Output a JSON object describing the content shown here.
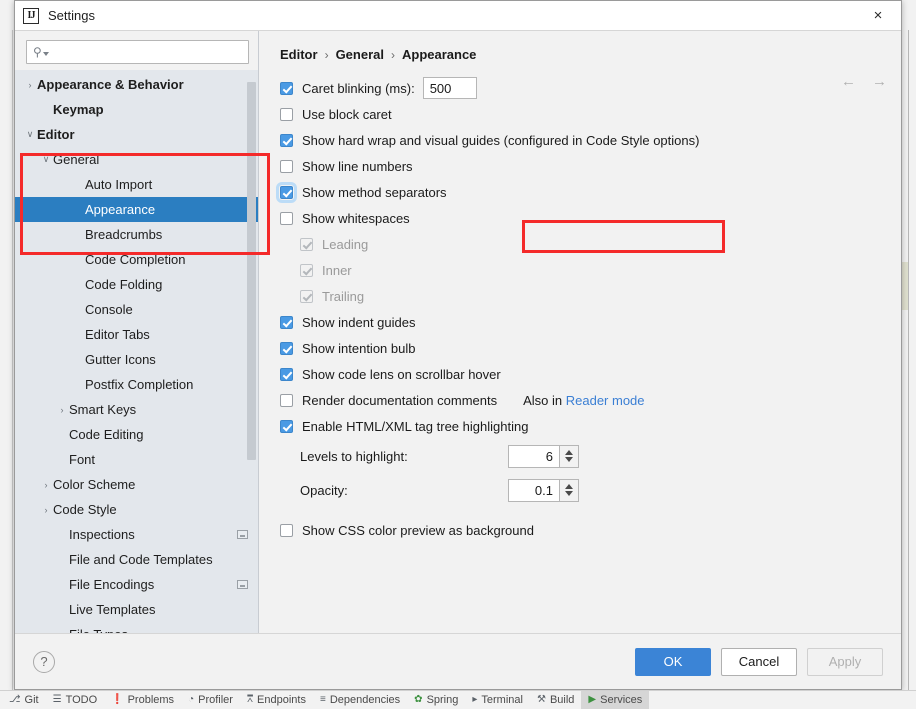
{
  "window": {
    "title": "Settings",
    "app_icon": "intellij-idea-icon",
    "close_label": "×"
  },
  "sidebar": {
    "search": {
      "placeholder": "",
      "value": "",
      "icon": "search-icon"
    },
    "items": [
      {
        "label": "Appearance & Behavior",
        "indent": 0,
        "twisty": "›",
        "bold": true,
        "selected": false,
        "badge": false
      },
      {
        "label": "Keymap",
        "indent": 1,
        "twisty": "",
        "bold": true,
        "selected": false,
        "badge": false
      },
      {
        "label": "Editor",
        "indent": 0,
        "twisty": "⌄",
        "bold": true,
        "selected": false,
        "badge": false
      },
      {
        "label": "General",
        "indent": 1,
        "twisty": "⌄",
        "bold": false,
        "selected": false,
        "badge": false
      },
      {
        "label": "Auto Import",
        "indent": 3,
        "twisty": "",
        "bold": false,
        "selected": false,
        "badge": false
      },
      {
        "label": "Appearance",
        "indent": 3,
        "twisty": "",
        "bold": false,
        "selected": true,
        "badge": false
      },
      {
        "label": "Breadcrumbs",
        "indent": 3,
        "twisty": "",
        "bold": false,
        "selected": false,
        "badge": false
      },
      {
        "label": "Code Completion",
        "indent": 3,
        "twisty": "",
        "bold": false,
        "selected": false,
        "badge": false
      },
      {
        "label": "Code Folding",
        "indent": 3,
        "twisty": "",
        "bold": false,
        "selected": false,
        "badge": false
      },
      {
        "label": "Console",
        "indent": 3,
        "twisty": "",
        "bold": false,
        "selected": false,
        "badge": false
      },
      {
        "label": "Editor Tabs",
        "indent": 3,
        "twisty": "",
        "bold": false,
        "selected": false,
        "badge": false
      },
      {
        "label": "Gutter Icons",
        "indent": 3,
        "twisty": "",
        "bold": false,
        "selected": false,
        "badge": false
      },
      {
        "label": "Postfix Completion",
        "indent": 3,
        "twisty": "",
        "bold": false,
        "selected": false,
        "badge": false
      },
      {
        "label": "Smart Keys",
        "indent": 2,
        "twisty": "›",
        "bold": false,
        "selected": false,
        "badge": false
      },
      {
        "label": "Code Editing",
        "indent": 2,
        "twisty": "",
        "bold": false,
        "selected": false,
        "badge": false
      },
      {
        "label": "Font",
        "indent": 2,
        "twisty": "",
        "bold": false,
        "selected": false,
        "badge": false
      },
      {
        "label": "Color Scheme",
        "indent": 1,
        "twisty": "›",
        "bold": false,
        "selected": false,
        "badge": false
      },
      {
        "label": "Code Style",
        "indent": 1,
        "twisty": "›",
        "bold": false,
        "selected": false,
        "badge": false
      },
      {
        "label": "Inspections",
        "indent": 2,
        "twisty": "",
        "bold": false,
        "selected": false,
        "badge": true
      },
      {
        "label": "File and Code Templates",
        "indent": 2,
        "twisty": "",
        "bold": false,
        "selected": false,
        "badge": false
      },
      {
        "label": "File Encodings",
        "indent": 2,
        "twisty": "",
        "bold": false,
        "selected": false,
        "badge": true
      },
      {
        "label": "Live Templates",
        "indent": 2,
        "twisty": "",
        "bold": false,
        "selected": false,
        "badge": false
      },
      {
        "label": "File Types",
        "indent": 2,
        "twisty": "",
        "bold": false,
        "selected": false,
        "badge": false
      }
    ]
  },
  "main": {
    "breadcrumb": [
      "Editor",
      "General",
      "Appearance"
    ],
    "breadcrumb_separator": "›",
    "nav_back": "←",
    "nav_forward": "→",
    "caret_blinking": {
      "label": "Caret blinking (ms):",
      "checked": true,
      "value": "500"
    },
    "checkboxes": [
      {
        "label": "Use block caret",
        "checked": false,
        "disabled": false,
        "indent": false
      },
      {
        "label": "Show hard wrap and visual guides (configured in Code Style options)",
        "checked": true,
        "disabled": false,
        "indent": false
      },
      {
        "label": "Show line numbers",
        "checked": false,
        "disabled": false,
        "indent": false
      },
      {
        "label": "Show method separators",
        "checked": true,
        "disabled": false,
        "indent": false,
        "focused": true
      },
      {
        "label": "Show whitespaces",
        "checked": false,
        "disabled": false,
        "indent": false
      },
      {
        "label": "Leading",
        "checked": true,
        "disabled": true,
        "indent": true
      },
      {
        "label": "Inner",
        "checked": true,
        "disabled": true,
        "indent": true
      },
      {
        "label": "Trailing",
        "checked": true,
        "disabled": true,
        "indent": true
      },
      {
        "label": "Show indent guides",
        "checked": true,
        "disabled": false,
        "indent": false
      },
      {
        "label": "Show intention bulb",
        "checked": true,
        "disabled": false,
        "indent": false
      },
      {
        "label": "Show code lens on scrollbar hover",
        "checked": true,
        "disabled": false,
        "indent": false
      }
    ],
    "render_doc": {
      "label": "Render documentation comments",
      "checked": false,
      "note_prefix": "Also in ",
      "note_link": "Reader mode"
    },
    "tag_tree": {
      "label": "Enable HTML/XML tag tree highlighting",
      "checked": true
    },
    "spinners": [
      {
        "label": "Levels to highlight:",
        "value": "6"
      },
      {
        "label": "Opacity:",
        "value": "0.1"
      }
    ],
    "css_preview": {
      "label": "Show CSS color preview as background",
      "checked": false
    }
  },
  "footer": {
    "help": "?",
    "ok": "OK",
    "cancel": "Cancel",
    "apply": "Apply"
  },
  "statusbar": {
    "items": [
      {
        "label": "Git",
        "icon": "branch-icon",
        "active": false
      },
      {
        "label": "TODO",
        "icon": "list-icon",
        "active": false
      },
      {
        "label": "Problems",
        "icon": "warning-icon",
        "active": false
      },
      {
        "label": "Profiler",
        "icon": "gauge-icon",
        "active": false
      },
      {
        "label": "Endpoints",
        "icon": "endpoints-icon",
        "active": false
      },
      {
        "label": "Dependencies",
        "icon": "layers-icon",
        "active": false
      },
      {
        "label": "Spring",
        "icon": "leaf-icon",
        "active": false
      },
      {
        "label": "Terminal",
        "icon": "terminal-icon",
        "active": false
      },
      {
        "label": "Build",
        "icon": "hammer-icon",
        "active": false
      },
      {
        "label": "Services",
        "icon": "play-icon",
        "active": true
      }
    ]
  },
  "colors": {
    "accent": "#3b84d6",
    "selection": "#2b7ec1",
    "checkbox_checked": "#4a9ae4",
    "annotation": "#f42a2a",
    "link": "#3b7fd4"
  }
}
